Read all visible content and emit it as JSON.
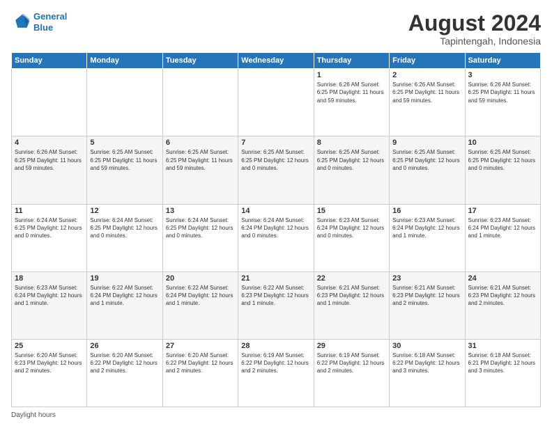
{
  "logo": {
    "line1": "General",
    "line2": "Blue"
  },
  "title": "August 2024",
  "subtitle": "Tapintengah, Indonesia",
  "header_days": [
    "Sunday",
    "Monday",
    "Tuesday",
    "Wednesday",
    "Thursday",
    "Friday",
    "Saturday"
  ],
  "footer": "Daylight hours",
  "weeks": [
    [
      {
        "day": "",
        "info": ""
      },
      {
        "day": "",
        "info": ""
      },
      {
        "day": "",
        "info": ""
      },
      {
        "day": "",
        "info": ""
      },
      {
        "day": "1",
        "info": "Sunrise: 6:26 AM\nSunset: 6:25 PM\nDaylight: 11 hours and 59 minutes."
      },
      {
        "day": "2",
        "info": "Sunrise: 6:26 AM\nSunset: 6:25 PM\nDaylight: 11 hours and 59 minutes."
      },
      {
        "day": "3",
        "info": "Sunrise: 6:26 AM\nSunset: 6:25 PM\nDaylight: 11 hours and 59 minutes."
      }
    ],
    [
      {
        "day": "4",
        "info": "Sunrise: 6:26 AM\nSunset: 6:25 PM\nDaylight: 11 hours and 59 minutes."
      },
      {
        "day": "5",
        "info": "Sunrise: 6:25 AM\nSunset: 6:25 PM\nDaylight: 11 hours and 59 minutes."
      },
      {
        "day": "6",
        "info": "Sunrise: 6:25 AM\nSunset: 6:25 PM\nDaylight: 11 hours and 59 minutes."
      },
      {
        "day": "7",
        "info": "Sunrise: 6:25 AM\nSunset: 6:25 PM\nDaylight: 12 hours and 0 minutes."
      },
      {
        "day": "8",
        "info": "Sunrise: 6:25 AM\nSunset: 6:25 PM\nDaylight: 12 hours and 0 minutes."
      },
      {
        "day": "9",
        "info": "Sunrise: 6:25 AM\nSunset: 6:25 PM\nDaylight: 12 hours and 0 minutes."
      },
      {
        "day": "10",
        "info": "Sunrise: 6:25 AM\nSunset: 6:25 PM\nDaylight: 12 hours and 0 minutes."
      }
    ],
    [
      {
        "day": "11",
        "info": "Sunrise: 6:24 AM\nSunset: 6:25 PM\nDaylight: 12 hours and 0 minutes."
      },
      {
        "day": "12",
        "info": "Sunrise: 6:24 AM\nSunset: 6:25 PM\nDaylight: 12 hours and 0 minutes."
      },
      {
        "day": "13",
        "info": "Sunrise: 6:24 AM\nSunset: 6:25 PM\nDaylight: 12 hours and 0 minutes."
      },
      {
        "day": "14",
        "info": "Sunrise: 6:24 AM\nSunset: 6:24 PM\nDaylight: 12 hours and 0 minutes."
      },
      {
        "day": "15",
        "info": "Sunrise: 6:23 AM\nSunset: 6:24 PM\nDaylight: 12 hours and 0 minutes."
      },
      {
        "day": "16",
        "info": "Sunrise: 6:23 AM\nSunset: 6:24 PM\nDaylight: 12 hours and 1 minute."
      },
      {
        "day": "17",
        "info": "Sunrise: 6:23 AM\nSunset: 6:24 PM\nDaylight: 12 hours and 1 minute."
      }
    ],
    [
      {
        "day": "18",
        "info": "Sunrise: 6:23 AM\nSunset: 6:24 PM\nDaylight: 12 hours and 1 minute."
      },
      {
        "day": "19",
        "info": "Sunrise: 6:22 AM\nSunset: 6:24 PM\nDaylight: 12 hours and 1 minute."
      },
      {
        "day": "20",
        "info": "Sunrise: 6:22 AM\nSunset: 6:24 PM\nDaylight: 12 hours and 1 minute."
      },
      {
        "day": "21",
        "info": "Sunrise: 6:22 AM\nSunset: 6:23 PM\nDaylight: 12 hours and 1 minute."
      },
      {
        "day": "22",
        "info": "Sunrise: 6:21 AM\nSunset: 6:23 PM\nDaylight: 12 hours and 1 minute."
      },
      {
        "day": "23",
        "info": "Sunrise: 6:21 AM\nSunset: 6:23 PM\nDaylight: 12 hours and 2 minutes."
      },
      {
        "day": "24",
        "info": "Sunrise: 6:21 AM\nSunset: 6:23 PM\nDaylight: 12 hours and 2 minutes."
      }
    ],
    [
      {
        "day": "25",
        "info": "Sunrise: 6:20 AM\nSunset: 6:23 PM\nDaylight: 12 hours and 2 minutes."
      },
      {
        "day": "26",
        "info": "Sunrise: 6:20 AM\nSunset: 6:22 PM\nDaylight: 12 hours and 2 minutes."
      },
      {
        "day": "27",
        "info": "Sunrise: 6:20 AM\nSunset: 6:22 PM\nDaylight: 12 hours and 2 minutes."
      },
      {
        "day": "28",
        "info": "Sunrise: 6:19 AM\nSunset: 6:22 PM\nDaylight: 12 hours and 2 minutes."
      },
      {
        "day": "29",
        "info": "Sunrise: 6:19 AM\nSunset: 6:22 PM\nDaylight: 12 hours and 2 minutes."
      },
      {
        "day": "30",
        "info": "Sunrise: 6:18 AM\nSunset: 6:22 PM\nDaylight: 12 hours and 3 minutes."
      },
      {
        "day": "31",
        "info": "Sunrise: 6:18 AM\nSunset: 6:21 PM\nDaylight: 12 hours and 3 minutes."
      }
    ]
  ]
}
